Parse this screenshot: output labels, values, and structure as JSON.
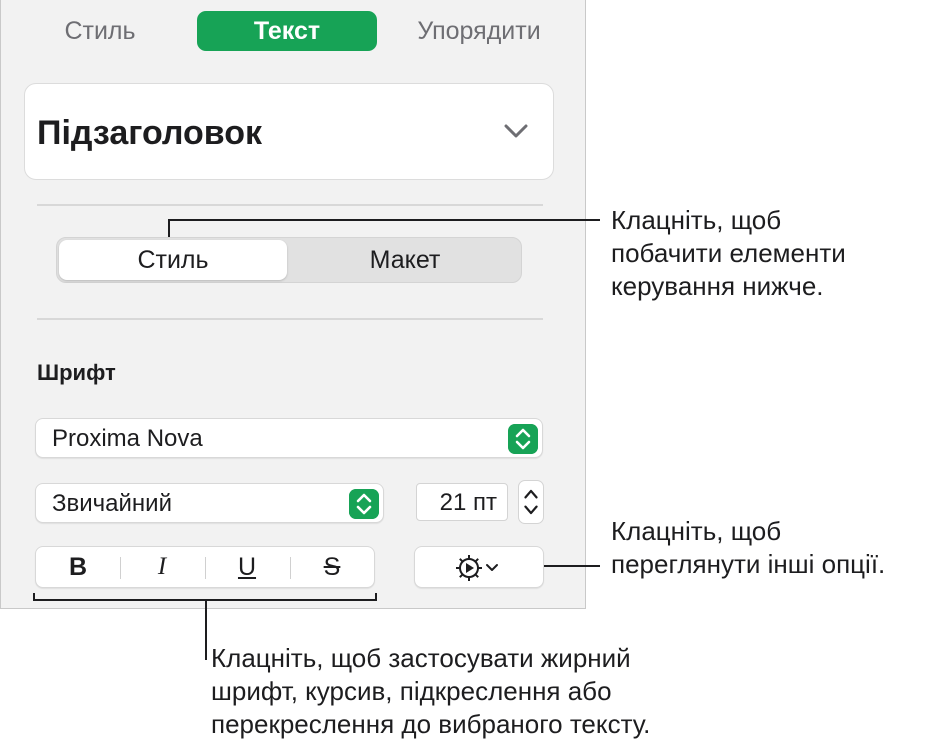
{
  "tabs": {
    "style": "Стиль",
    "text": "Текст",
    "arrange": "Упорядити"
  },
  "paragraph_style": {
    "value": "Підзаголовок"
  },
  "segment": {
    "style": "Стиль",
    "layout": "Макет"
  },
  "font_section": {
    "label": "Шрифт",
    "font_name": "Proxima Nova",
    "font_weight": "Звичайний",
    "font_size": "21 пт"
  },
  "format_buttons": {
    "bold": "B",
    "italic": "I",
    "underline": "U",
    "strikethrough": "S"
  },
  "callouts": {
    "segment": [
      "Клацніть, щоб",
      "побачити елементи",
      "керування нижче."
    ],
    "gear": [
      "Клацніть, щоб",
      "переглянути інші опції."
    ],
    "format": [
      "Клацніть, щоб застосувати жирний",
      "шрифт, курсив, підкреслення або",
      "перекреслення до вибраного тексту."
    ]
  },
  "colors": {
    "accent": "#17a356",
    "panel_bg": "#f2f2f2"
  },
  "icons": [
    "chevron-down-icon",
    "up-down-arrows-icon",
    "gear-icon"
  ]
}
